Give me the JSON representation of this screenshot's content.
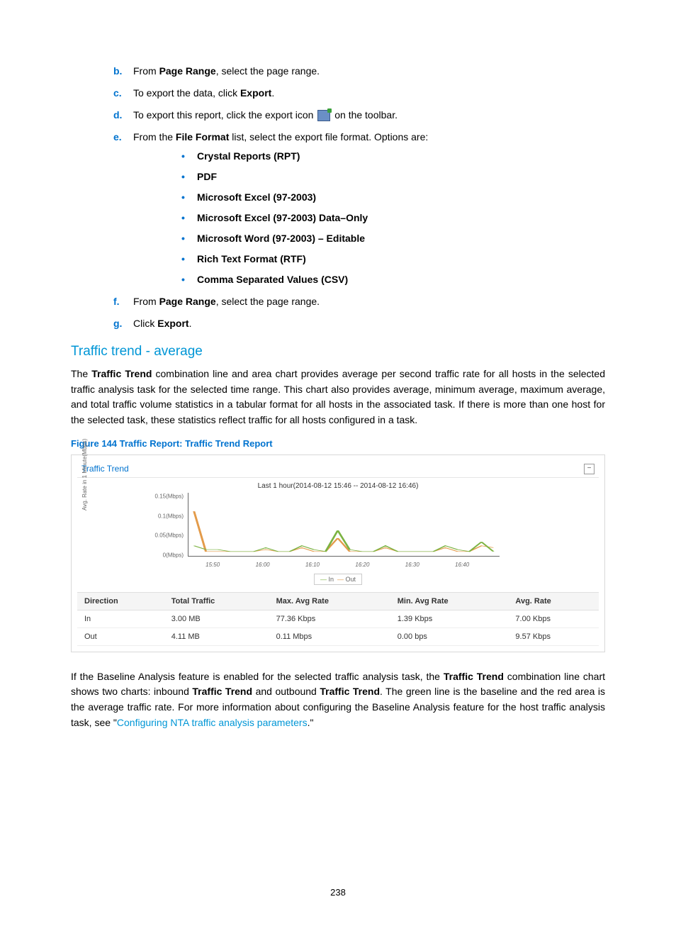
{
  "steps": {
    "b": {
      "pre": "From ",
      "bold1": "Page Range",
      "post": ", select the page range."
    },
    "c": {
      "pre": "To export the data, click ",
      "bold1": "Export",
      "post": "."
    },
    "d": {
      "pre": "To export this report, click the export icon ",
      "post": " on the toolbar."
    },
    "e": {
      "pre": "From the ",
      "bold1": "File Format",
      "post": " list, select the export file format. Options are:"
    },
    "f": {
      "pre": "From ",
      "bold1": "Page Range",
      "post": ", select the page range."
    },
    "g": {
      "pre": "Click ",
      "bold1": "Export",
      "post": "."
    }
  },
  "formats": [
    "Crystal Reports (RPT)",
    "PDF",
    "Microsoft Excel (97-2003)",
    "Microsoft Excel (97-2003) Data–Only",
    "Microsoft Word (97-2003) – Editable",
    "Rich Text Format (RTF)",
    "Comma Separated Values (CSV)"
  ],
  "section_heading": "Traffic trend - average",
  "para1": {
    "p1": "The ",
    "b1": "Traffic Trend",
    "p2": " combination line and area chart provides average per second traffic rate for all hosts in the selected traffic analysis task for the selected time range. This chart also provides average, minimum average, maximum average, and total traffic volume statistics in a tabular format for all hosts in the associated task. If there is more than one host for the selected task, these statistics reflect traffic for all hosts configured in a task."
  },
  "figcap": "Figure 144 Traffic Report: Traffic Trend Report",
  "panel_title": "Traffic Trend",
  "chart_subtitle": "Last 1 hour(2014-08-12 15:46 -- 2014-08-12 16:46)",
  "legend": {
    "in": "In",
    "out": "Out"
  },
  "table": {
    "headers": [
      "Direction",
      "Total Traffic",
      "Max. Avg Rate",
      "Min. Avg Rate",
      "Avg. Rate"
    ],
    "rows": [
      [
        "In",
        "3.00 MB",
        "77.36 Kbps",
        "1.39 Kbps",
        "7.00 Kbps"
      ],
      [
        "Out",
        "4.11 MB",
        "0.11 Mbps",
        "0.00 bps",
        "9.57 Kbps"
      ]
    ]
  },
  "para2": {
    "p1": "If the Baseline Analysis feature is enabled for the selected traffic analysis task, the ",
    "b1": "Traffic Trend",
    "p2": " combination line chart shows two charts: inbound ",
    "b2": "Traffic Trend",
    "p3": " and outbound ",
    "b3": "Traffic Trend",
    "p4": ". The green line is the baseline and the red area is the average traffic rate. For more information about configuring the Baseline Analysis feature for the host traffic analysis task, see \"",
    "link": "Configuring NTA traffic analysis parameters",
    "p5": ".\""
  },
  "pagenum": "238",
  "chart_data": {
    "type": "line",
    "title": "Last 1 hour(2014-08-12 15:46 -- 2014-08-12 16:46)",
    "ylabel": "Avg. Rate in 1 Minute(Mbps)",
    "yticks": [
      "0(Mbps)",
      "0.05(Mbps)",
      "0.1(Mbps)",
      "0.15(Mbps)"
    ],
    "ylim": [
      0,
      0.15
    ],
    "xticks": [
      "15:50",
      "16:00",
      "16:10",
      "16:20",
      "16:30",
      "16:40"
    ],
    "series": [
      {
        "name": "In",
        "color": "#7cb342",
        "values": [
          0.02,
          0.01,
          0.01,
          0.005,
          0.005,
          0.005,
          0.015,
          0.005,
          0.005,
          0.02,
          0.01,
          0.005,
          0.06,
          0.01,
          0.005,
          0.005,
          0.02,
          0.005,
          0.005,
          0.005,
          0.005,
          0.02,
          0.01,
          0.005,
          0.03,
          0.005
        ]
      },
      {
        "name": "Out",
        "color": "#e39b4a",
        "values": [
          0.11,
          0.005,
          0.005,
          0.005,
          0.005,
          0.005,
          0.01,
          0.005,
          0.005,
          0.015,
          0.005,
          0.005,
          0.04,
          0.005,
          0.005,
          0.005,
          0.015,
          0.005,
          0.005,
          0.005,
          0.005,
          0.015,
          0.005,
          0.005,
          0.02,
          0.015
        ]
      }
    ]
  }
}
